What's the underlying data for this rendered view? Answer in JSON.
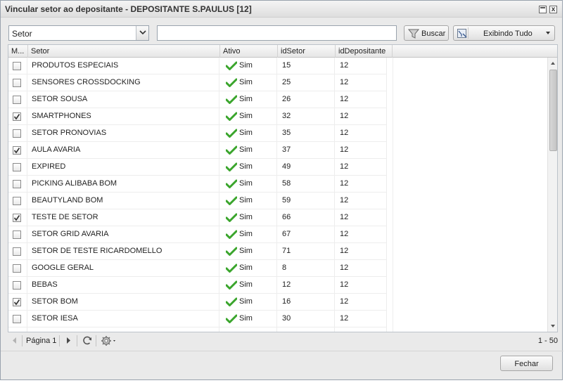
{
  "window": {
    "title": "Vincular setor ao depositante - DEPOSITANTE S.PAULUS [12]",
    "close_glyph": "x"
  },
  "toolbar": {
    "field_combo_value": "Setor",
    "search_value": "",
    "search_button_label": "Buscar",
    "filter_button_label": "Exibindo Tudo"
  },
  "grid": {
    "columns": [
      "M...",
      "Setor",
      "Ativo",
      "idSetor",
      "idDepositante"
    ],
    "rows": [
      {
        "checked": false,
        "setor": "PRODUTOS ESPECIAIS",
        "ativo": "Sim",
        "idSetor": "15",
        "idDepositante": "12"
      },
      {
        "checked": false,
        "setor": "SENSORES CROSSDOCKING",
        "ativo": "Sim",
        "idSetor": "25",
        "idDepositante": "12"
      },
      {
        "checked": false,
        "setor": "SETOR SOUSA",
        "ativo": "Sim",
        "idSetor": "26",
        "idDepositante": "12"
      },
      {
        "checked": true,
        "setor": "SMARTPHONES",
        "ativo": "Sim",
        "idSetor": "32",
        "idDepositante": "12"
      },
      {
        "checked": false,
        "setor": "SETOR PRONOVIAS",
        "ativo": "Sim",
        "idSetor": "35",
        "idDepositante": "12"
      },
      {
        "checked": true,
        "setor": "AULA AVARIA",
        "ativo": "Sim",
        "idSetor": "37",
        "idDepositante": "12"
      },
      {
        "checked": false,
        "setor": "EXPIRED",
        "ativo": "Sim",
        "idSetor": "49",
        "idDepositante": "12"
      },
      {
        "checked": false,
        "setor": "PICKING ALIBABA BOM",
        "ativo": "Sim",
        "idSetor": "58",
        "idDepositante": "12"
      },
      {
        "checked": false,
        "setor": "BEAUTYLAND BOM",
        "ativo": "Sim",
        "idSetor": "59",
        "idDepositante": "12"
      },
      {
        "checked": true,
        "setor": "TESTE DE SETOR",
        "ativo": "Sim",
        "idSetor": "66",
        "idDepositante": "12"
      },
      {
        "checked": false,
        "setor": "SETOR GRID AVARIA",
        "ativo": "Sim",
        "idSetor": "67",
        "idDepositante": "12"
      },
      {
        "checked": false,
        "setor": "SETOR DE TESTE RICARDOMELLO",
        "ativo": "Sim",
        "idSetor": "71",
        "idDepositante": "12"
      },
      {
        "checked": false,
        "setor": "GOOGLE GERAL",
        "ativo": "Sim",
        "idSetor": "8",
        "idDepositante": "12"
      },
      {
        "checked": false,
        "setor": "BEBAS",
        "ativo": "Sim",
        "idSetor": "12",
        "idDepositante": "12"
      },
      {
        "checked": true,
        "setor": "SETOR BOM",
        "ativo": "Sim",
        "idSetor": "16",
        "idDepositante": "12"
      },
      {
        "checked": false,
        "setor": "SETOR IESA",
        "ativo": "Sim",
        "idSetor": "30",
        "idDepositante": "12"
      },
      {
        "checked": false,
        "setor": "",
        "ativo": "",
        "idSetor": "",
        "idDepositante": ""
      }
    ]
  },
  "paging": {
    "page_label": "Página 1",
    "count_label": "1 - 50"
  },
  "footer": {
    "close_label": "Fechar"
  },
  "icons": {
    "check": "green-check-icon",
    "filter": "funnel-icon",
    "refresh": "refresh-icon",
    "settings": "gear-icon"
  },
  "colors": {
    "check_green": "#3aa52c",
    "window_bg": "#eaeaea"
  }
}
